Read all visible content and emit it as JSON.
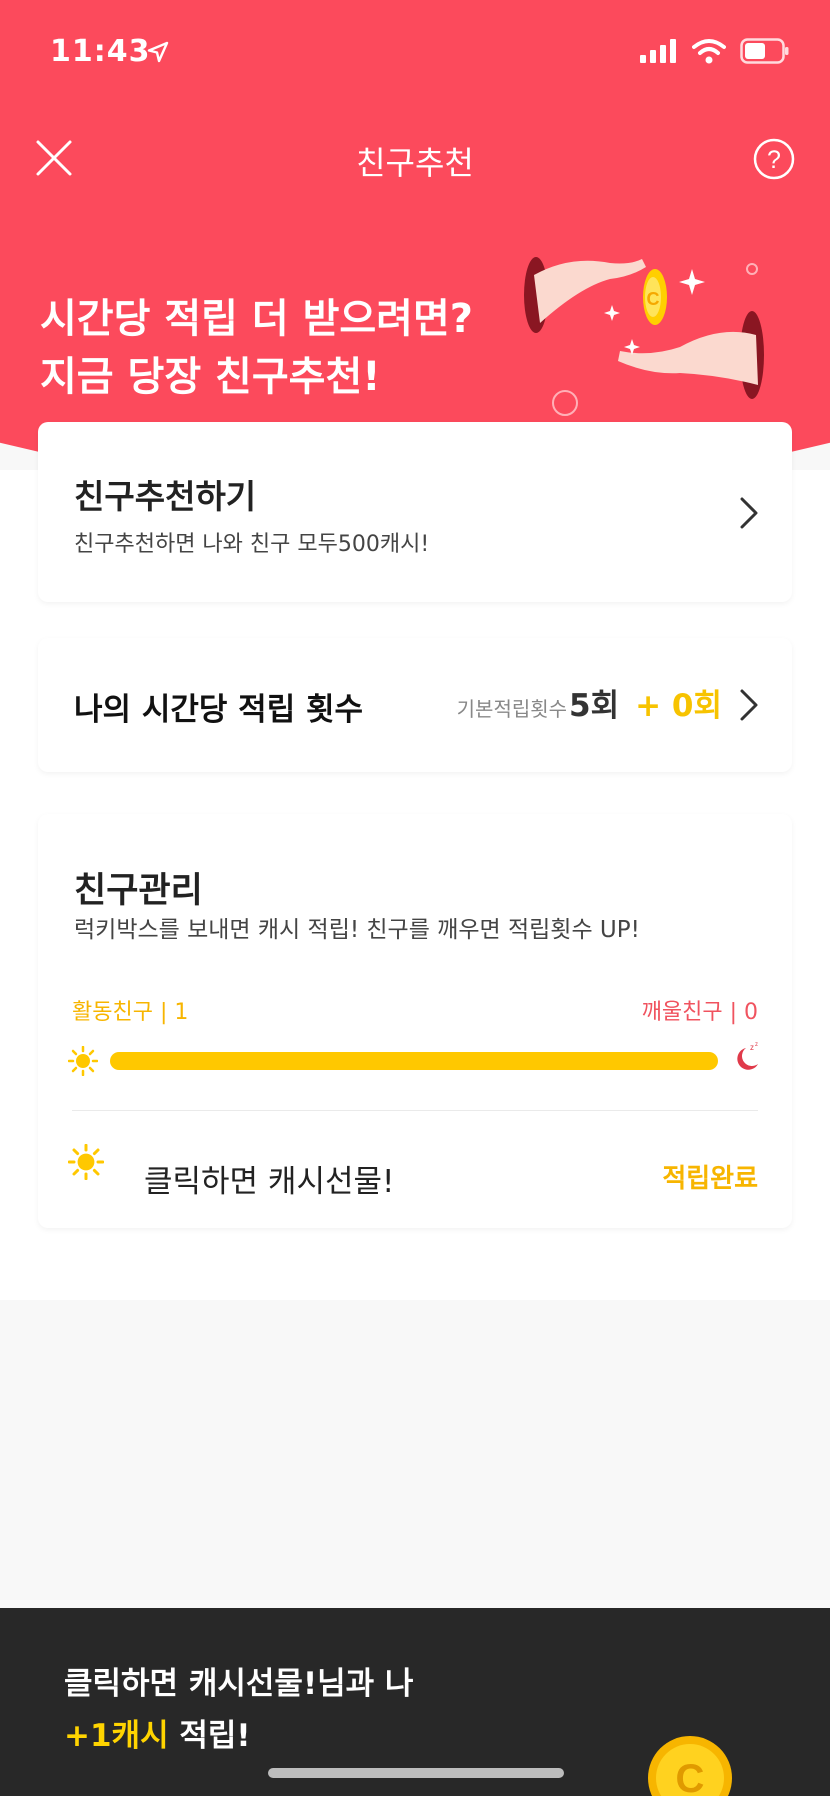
{
  "status_bar": {
    "time": "11:43"
  },
  "nav": {
    "title": "친구추천",
    "close_icon": "close-icon",
    "help_icon": "help-icon"
  },
  "hero": {
    "line1": "시간당 적립 더 받으려면?",
    "line2": "지금 당장 친구추천!"
  },
  "refer_card": {
    "title": "친구추천하기",
    "subtitle": "친구추천하면 나와 친구 모두500캐시!"
  },
  "hourly_card": {
    "title": "나의 시간당 적립 횟수",
    "base_label": "기본적립횟수",
    "base_count": "5회",
    "bonus": "+ 0회"
  },
  "friends_card": {
    "title": "친구관리",
    "subtitle": "럭키박스를 보내면 캐시 적립! 친구를 깨우면 적립횟수 UP!",
    "active_label": "활동친구 | 1",
    "sleeping_label": "깨울친구 | 0",
    "active_ratio": 1.0,
    "gift_label": "클릭하면 캐시선물!",
    "gift_status": "적립완료"
  },
  "bottom_banner": {
    "line1": "클릭하면 캐시선물!님과 나",
    "line2_highlight": "+1캐시",
    "line2_rest": " 적립!"
  },
  "colors": {
    "brand_red": "#fc4a5c",
    "accent_yellow": "#f7b500",
    "banner_dark": "#282828"
  }
}
